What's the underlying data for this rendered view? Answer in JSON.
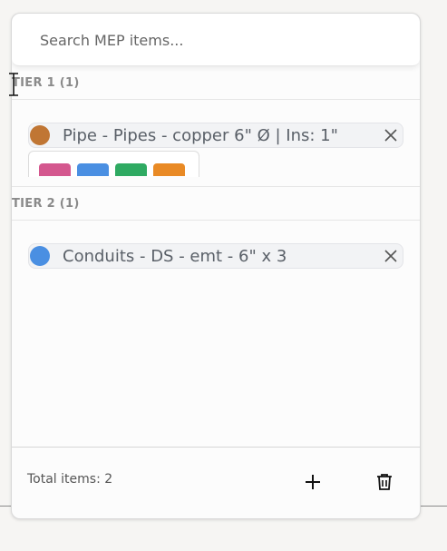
{
  "search": {
    "placeholder": "Search MEP items..."
  },
  "tiers": [
    {
      "label": "TIER 1 (1)",
      "items": [
        {
          "label": "Pipe - Pipes - copper 6\" Ø | Ins: 1\"",
          "color": "#c07634"
        }
      ]
    },
    {
      "label": "TIER 2 (1)",
      "items": [
        {
          "label": "Conduits - DS - emt - 6\" x 3",
          "color": "#4a8fe2"
        }
      ]
    }
  ],
  "color_swatches": [
    "#d4578e",
    "#4a8fe2",
    "#2faa62",
    "#e98a25"
  ],
  "footer": {
    "total_label": "Total items: 2"
  },
  "icons": {
    "add": "plus-icon",
    "delete": "trash-icon",
    "remove": "close-icon",
    "cursor": "text-cursor-icon"
  }
}
